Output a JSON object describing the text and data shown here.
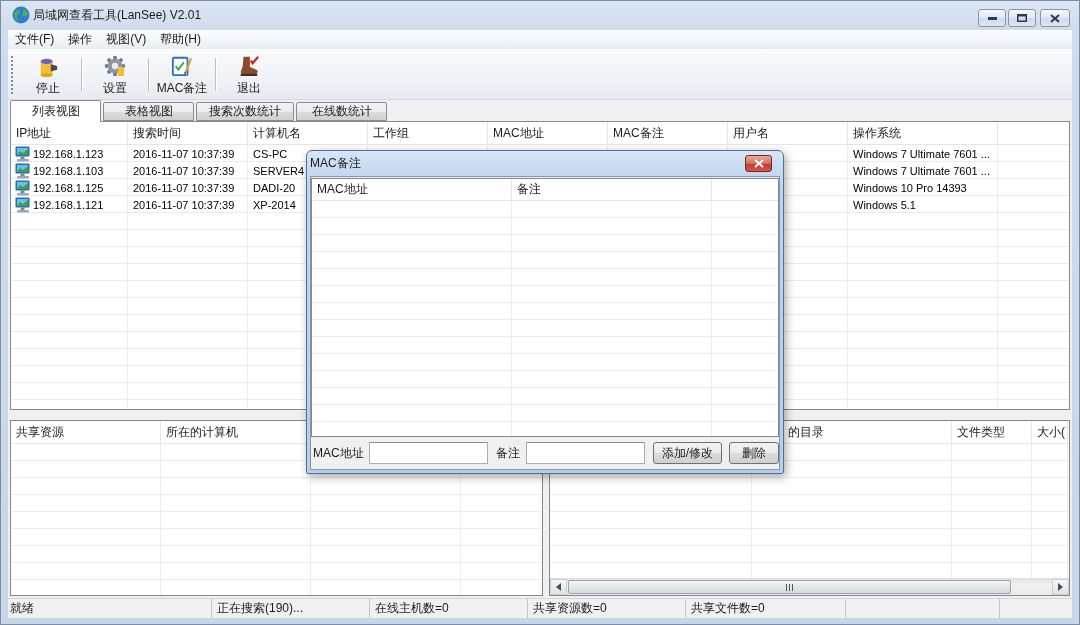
{
  "window": {
    "title": "局域网查看工具(LanSee) V2.01"
  },
  "menu": [
    "文件(F)",
    "操作",
    "视图(V)",
    "帮助(H)"
  ],
  "toolbar": [
    {
      "label": "停止",
      "kind": "stop"
    },
    {
      "label": "设置",
      "kind": "settings"
    },
    {
      "label": "MAC备注",
      "kind": "note"
    },
    {
      "label": "退出",
      "kind": "exit"
    }
  ],
  "tabs": [
    {
      "label": "列表视图",
      "selected": true
    },
    {
      "label": "表格视图",
      "selected": false
    },
    {
      "label": "搜索次数统计",
      "selected": false
    },
    {
      "label": "在线数统计",
      "selected": false
    }
  ],
  "host_table": {
    "columns": [
      "IP地址",
      "搜索时间",
      "计算机名",
      "工作组",
      "MAC地址",
      "MAC备注",
      "用户名",
      "操作系统"
    ],
    "rows": [
      {
        "ip_address": "192.168.1.123",
        "search_time": "2016-11-07 10:37:39",
        "computer_name": "CS-PC",
        "operating_system": "Windows 7 Ultimate 7601 ..."
      },
      {
        "ip_address": "192.168.1.103",
        "search_time": "2016-11-07 10:37:39",
        "computer_name": "SERVER4",
        "operating_system": "Windows 7 Ultimate 7601 ..."
      },
      {
        "ip_address": "192.168.1.125",
        "search_time": "2016-11-07 10:37:39",
        "computer_name": "DADI-20",
        "operating_system": "Windows 10 Pro 14393"
      },
      {
        "ip_address": "192.168.1.121",
        "search_time": "2016-11-07 10:37:39",
        "computer_name": "XP-2014",
        "operating_system": "Windows 5.1"
      }
    ]
  },
  "share_table": {
    "columns": [
      "共享资源",
      "所在的计算机"
    ]
  },
  "file_table": {
    "columns": [
      "的目录",
      "文件类型",
      "大小("
    ]
  },
  "dialog": {
    "title": "MAC备注",
    "columns": [
      "MAC地址",
      "备注"
    ],
    "fields": [
      {
        "label": "MAC地址"
      },
      {
        "label": "备注"
      }
    ],
    "buttons": [
      "添加/修改",
      "删除"
    ]
  },
  "status_bar": [
    "就绪",
    "正在搜索(190)...",
    "在线主机数=0",
    "共享资源数=0",
    "共享文件数=0"
  ]
}
